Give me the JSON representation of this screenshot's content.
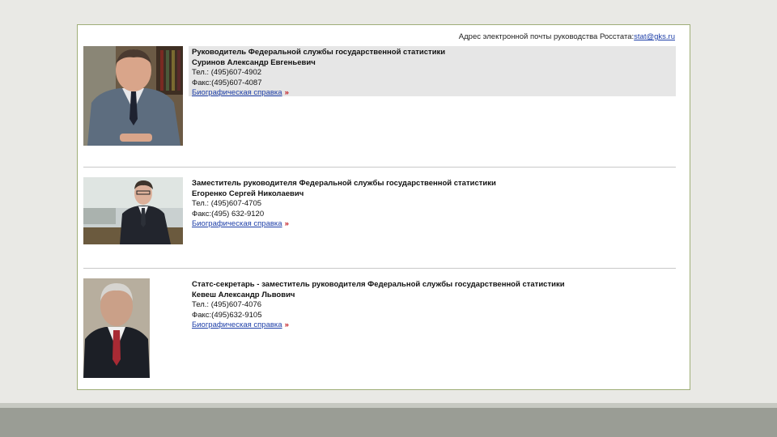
{
  "header": {
    "email_label": "Адрес электронной почты руководства Росстата:",
    "email_link": "stat@gks.ru"
  },
  "colors": {
    "background": "#e9e9e5",
    "panel_border": "#9fae78",
    "link": "#1e3fa8",
    "arrow": "#c0141a"
  },
  "persons": [
    {
      "role": "Руководитель Федеральной службы государственной статистики",
      "name": "Суринов Александр Евгеньевич",
      "phone": "Тел.: (495)607-4902",
      "fax": "Факс:(495)607-4087",
      "bio_label": "Биографическая справка",
      "arrow": "»"
    },
    {
      "role": "Заместитель руководителя Федеральной службы государственной статистики",
      "name": "Егоренко Сергей Николаевич",
      "phone": "Тел.: (495)607-4705",
      "fax": "Факс:(495) 632-9120",
      "bio_label": "Биографическая справка",
      "arrow": "»"
    },
    {
      "role": "Статс-секретарь - заместитель руководителя Федеральной службы государственной статистики",
      "name": "Кевеш Александр Львович",
      "phone": "Тел.: (495)607-4076",
      "fax": "Факс:(495)632-9105",
      "bio_label": "Биографическая справка",
      "arrow": "»"
    }
  ]
}
